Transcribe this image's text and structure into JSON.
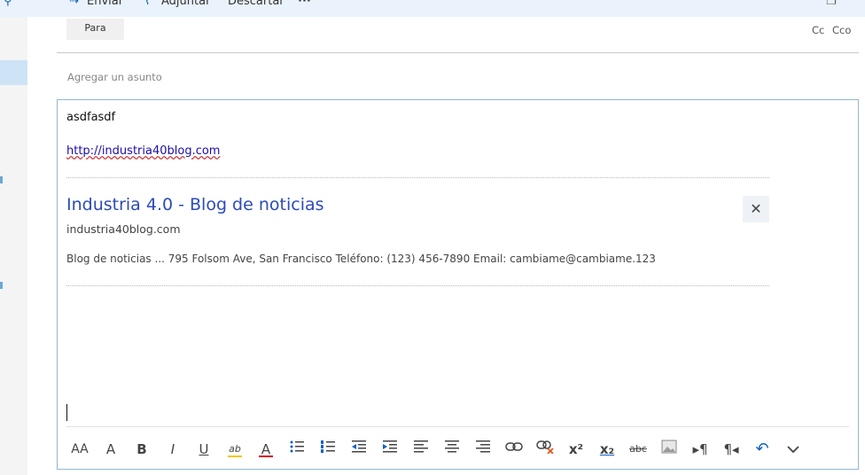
{
  "toolbar": {
    "send_label": "Enviar",
    "attach_label": "Adjuntar",
    "discard_label": "Descartar",
    "more_label": "···"
  },
  "compose": {
    "to_button": "Para",
    "cc_label": "Cc",
    "bcc_label": "Cco",
    "subject_placeholder": "Agregar un asunto"
  },
  "body": {
    "text": "asdfasdf",
    "link": "http://industria40blog.com"
  },
  "link_preview": {
    "title": "Industria 4.0 - Blog de noticias",
    "domain": "industria40blog.com",
    "description": "Blog de noticias ... 795 Folsom Ave, San Francisco Teléfono: (123) 456-7890 Email: cambiame@cambiame.123",
    "close_glyph": "✕"
  },
  "format_toolbar": {
    "font_size_glyph": "AA",
    "grow_font_glyph": "A",
    "bold_glyph": "B",
    "italic_glyph": "I",
    "underline_glyph": "U",
    "highlight_glyph": "ab",
    "font_color_glyph": "A",
    "highlight_color": "#f2c811",
    "font_color": "#d0021b",
    "superscript_glyph": "x²",
    "subscript_glyph": "x₂",
    "strikethrough_glyph": "abc"
  },
  "colors": {
    "accent": "#0b63c1",
    "link_title": "#2b4bb8",
    "editor_border": "#8fb6d8"
  }
}
